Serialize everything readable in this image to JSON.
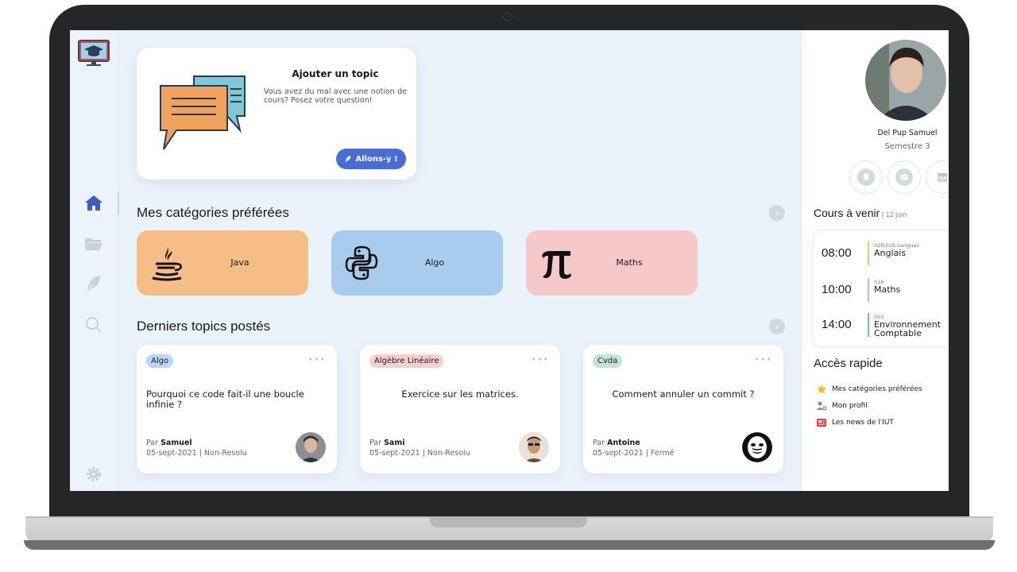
{
  "add_topic": {
    "title": "Ajouter un topic",
    "text": "Vous avez du mal avec une notion de cours? Posez votre question!",
    "button": "Allons-y !"
  },
  "sections": {
    "categories_title": "Mes catégories préférées",
    "topics_title": "Derniers topics postés"
  },
  "categories": [
    {
      "label": "Java",
      "color": "#f4be86",
      "icon": "java-icon"
    },
    {
      "label": "Algo",
      "color": "#a9cbec",
      "icon": "python-icon"
    },
    {
      "label": "Maths",
      "color": "#f5c9c9",
      "icon": "pi-icon"
    }
  ],
  "topics": [
    {
      "tag": "Algo",
      "tag_color": "#bcd7f2",
      "question": "Pourquoi ce code fait-il une boucle infinie ?",
      "by_prefix": "Par ",
      "author": "Samuel",
      "meta": "05-sept-2021 | Non-Resolu"
    },
    {
      "tag": "Algèbre Linéaire",
      "tag_color": "#f6cfcf",
      "question": "Exercice sur les matrices.",
      "by_prefix": "Par ",
      "author": "Sami",
      "meta": "05-sept-2021 | Non-Resolu"
    },
    {
      "tag": "Cvda",
      "tag_color": "#bfe6d6",
      "question": "Comment annuler un commit ?",
      "by_prefix": "Par ",
      "author": "Antoine",
      "meta": "05-sept-2021 | Fermé"
    }
  ],
  "profile": {
    "name": "Del Pup Samuel",
    "semester": "Semestre 3"
  },
  "cours": {
    "title": "Cours à venir",
    "date": " | 12 juin",
    "items": [
      {
        "time": "08:00",
        "room": "028\\026-Langues",
        "name": "Anglais",
        "color": "#f0c27a"
      },
      {
        "time": "10:00",
        "room": "S16",
        "name": "Maths",
        "color": "#f3a9a9"
      },
      {
        "time": "14:00",
        "room": "S03",
        "name": "Environnement Comptable",
        "color": "#6fc79a"
      }
    ]
  },
  "acces": {
    "title": "Accès rapide",
    "items": [
      "Mes catégories préférées",
      "Mon profil",
      "Les news de l'IUT"
    ]
  },
  "colors": {
    "accent": "#4a6cd8",
    "nav_active": "#3f5fbf",
    "screen_bg": "#eaf2fc"
  }
}
